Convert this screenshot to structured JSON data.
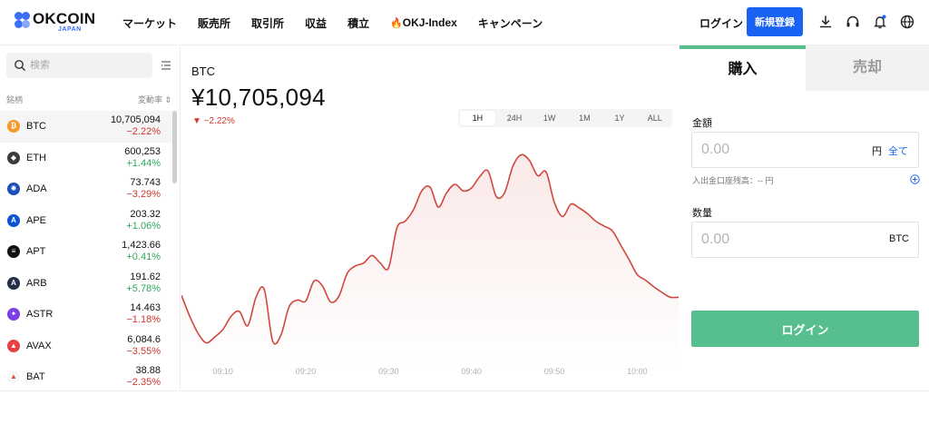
{
  "brand": {
    "name": "OKCOIN",
    "sub": "JAPAN",
    "color": "#3b6ff5"
  },
  "nav": [
    {
      "label": "マーケット"
    },
    {
      "label": "販売所"
    },
    {
      "label": "取引所"
    },
    {
      "label": "収益"
    },
    {
      "label": "積立"
    },
    {
      "label": "OKJ-Index",
      "icon": "flame-icon"
    },
    {
      "label": "キャンペーン"
    }
  ],
  "header": {
    "login_label": "ログイン",
    "signup_label": "新規登録",
    "signup_color": "#1a63f2",
    "icons": [
      "download-icon",
      "headset-icon",
      "bell-icon",
      "globe-icon"
    ]
  },
  "sidebar": {
    "search_placeholder": "検索",
    "col_name": "銘柄",
    "col_change": "変動率 ⇕",
    "coins": [
      {
        "symbol": "BTC",
        "price": "10,705,094",
        "change": "−2.22%",
        "dir": "down",
        "color": "#f39a2b",
        "glyph": "₿"
      },
      {
        "symbol": "ETH",
        "price": "600,253",
        "change": "+1.44%",
        "dir": "up",
        "color": "#3c3c3d",
        "glyph": "◆"
      },
      {
        "symbol": "ADA",
        "price": "73.743",
        "change": "−3.29%",
        "dir": "down",
        "color": "#1e4fb8",
        "glyph": "✺"
      },
      {
        "symbol": "APE",
        "price": "203.32",
        "change": "+1.06%",
        "dir": "up",
        "color": "#0b54d6",
        "glyph": "A"
      },
      {
        "symbol": "APT",
        "price": "1,423.66",
        "change": "+0.41%",
        "dir": "up",
        "color": "#111111",
        "glyph": "≡"
      },
      {
        "symbol": "ARB",
        "price": "191.62",
        "change": "+5.78%",
        "dir": "up",
        "color": "#213147",
        "glyph": "A"
      },
      {
        "symbol": "ASTR",
        "price": "14.463",
        "change": "−1.18%",
        "dir": "down",
        "color": "#7b3fe4",
        "glyph": "✦"
      },
      {
        "symbol": "AVAX",
        "price": "6,084.6",
        "change": "−3.55%",
        "dir": "down",
        "color": "#e84142",
        "glyph": "▲"
      },
      {
        "symbol": "BAT",
        "price": "38.88",
        "change": "−2.35%",
        "dir": "down",
        "color": "#f6f6f6",
        "glyph": "▲"
      }
    ]
  },
  "chart": {
    "pair": "BTC",
    "price": "¥10,705,094",
    "change": "−2.22%",
    "timeframes": [
      "1H",
      "24H",
      "1W",
      "1M",
      "1Y",
      "ALL"
    ],
    "active_timeframe": "1H",
    "line_color": "#d0473d"
  },
  "chart_data": {
    "type": "area",
    "x": [
      "09:05",
      "09:06",
      "09:07",
      "09:08",
      "09:09",
      "09:10",
      "09:11",
      "09:12",
      "09:13",
      "09:14",
      "09:15",
      "09:16",
      "09:17",
      "09:18",
      "09:19",
      "09:20",
      "09:21",
      "09:22",
      "09:23",
      "09:24",
      "09:25",
      "09:26",
      "09:27",
      "09:28",
      "09:29",
      "09:30",
      "09:31",
      "09:32",
      "09:33",
      "09:34",
      "09:35",
      "09:36",
      "09:37",
      "09:38",
      "09:39",
      "09:40",
      "09:41",
      "09:42",
      "09:43",
      "09:44",
      "09:45",
      "09:46",
      "09:47",
      "09:48",
      "09:49",
      "09:50",
      "09:51",
      "09:52",
      "09:53",
      "09:54",
      "09:55",
      "09:56",
      "09:57",
      "09:58",
      "09:59",
      "10:00",
      "10:01",
      "10:02",
      "10:03",
      "10:04",
      "10:05"
    ],
    "values": [
      302,
      280,
      262,
      252,
      258,
      266,
      280,
      285,
      270,
      300,
      308,
      254,
      260,
      290,
      297,
      296,
      317,
      312,
      295,
      301,
      325,
      333,
      336,
      344,
      336,
      331,
      373,
      380,
      392,
      412,
      416,
      395,
      410,
      419,
      412,
      415,
      427,
      433,
      406,
      410,
      438,
      450,
      444,
      428,
      432,
      400,
      385,
      398,
      394,
      388,
      380,
      375,
      370,
      355,
      340,
      324,
      318,
      311,
      305,
      300,
      300
    ],
    "xticks": [
      "09:10",
      "09:20",
      "09:30",
      "09:40",
      "09:50",
      "10:00"
    ],
    "grid": false,
    "legend": "none"
  },
  "trade": {
    "buy_label": "購入",
    "sell_label": "売却",
    "accent": "#56bf8d",
    "amount_label": "金額",
    "amount_placeholder": "0.00",
    "amount_unit": "円",
    "all_label": "全て",
    "balance_text": "入出金口座残高：-- 円",
    "qty_label": "数量",
    "qty_placeholder": "0.00",
    "qty_unit": "BTC",
    "login_button": "ログイン"
  }
}
